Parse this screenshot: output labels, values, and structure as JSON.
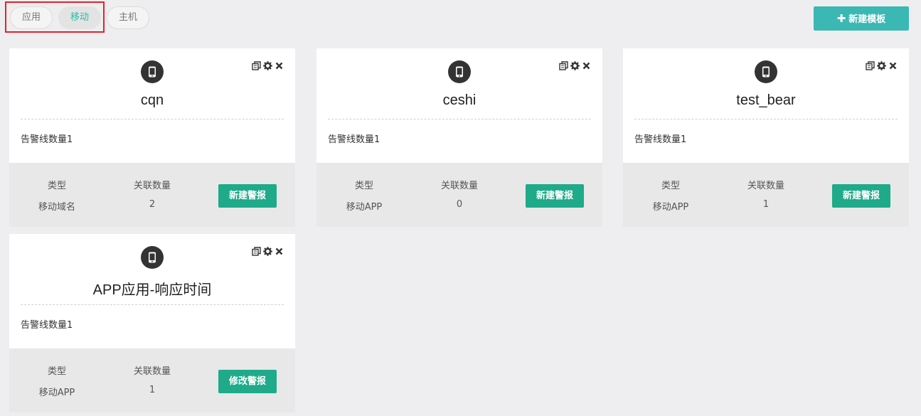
{
  "filter_tabs": [
    {
      "label": "应用"
    },
    {
      "label": "移动"
    },
    {
      "label": "主机"
    }
  ],
  "active_tab": "移动",
  "toolbar": {
    "new_template_label": "新建模板",
    "new_template_icon": "plus-icon"
  },
  "colors": {
    "accent": "#3bb8b4",
    "alert_button": "#1faa8a",
    "highlight_border": "#e8202a"
  },
  "card_labels": {
    "type": "类型",
    "link_count": "关联数量"
  },
  "cards": [
    {
      "icon": "mobile-icon",
      "title": "cqn",
      "desc": "告警线数量1",
      "type": "移动域名",
      "count": "2",
      "button": "新建警报"
    },
    {
      "icon": "mobile-icon",
      "title": "ceshi",
      "desc": "告警线数量1",
      "type": "移动APP",
      "count": "0",
      "button": "新建警报"
    },
    {
      "icon": "mobile-icon",
      "title": "test_bear",
      "desc": "告警线数量1",
      "type": "移动APP",
      "count": "1",
      "button": "新建警报"
    },
    {
      "icon": "mobile-icon",
      "title": "APP应用-响应时间",
      "desc": "告警线数量1",
      "type": "移动APP",
      "count": "1",
      "button": "修改警报"
    }
  ]
}
